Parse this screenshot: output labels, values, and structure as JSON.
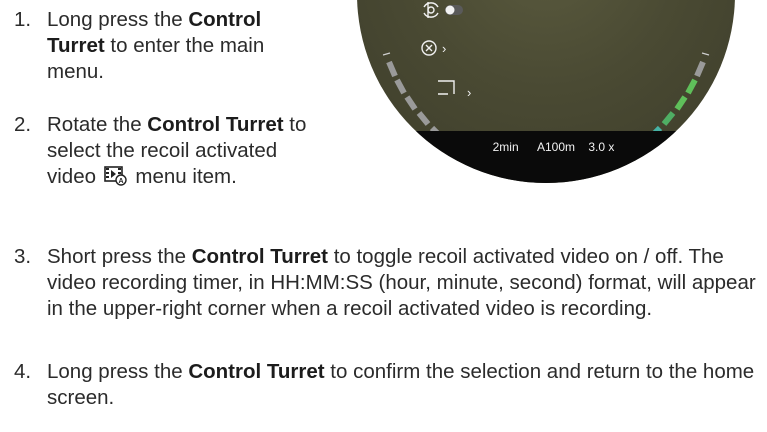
{
  "steps": [
    {
      "num": "1.",
      "parts": [
        "Long press the ",
        "Control Turret",
        " to enter the main menu."
      ]
    },
    {
      "num": "2.",
      "parts": [
        "Rotate the ",
        "Control Turret",
        " to select the recoil activated video ",
        " menu item."
      ]
    },
    {
      "num": "3.",
      "parts": [
        "Short press the ",
        "Control Turret",
        " to toggle recoil activated video on / off. The video recording timer, in HH:MM:SS (hour, minute, second) format, will appear in the upper-right corner when a recoil activated video is recording."
      ]
    },
    {
      "num": "4.",
      "parts": [
        "Long press the ",
        "Control Turret",
        " to confirm the selection and return to the home screen."
      ]
    }
  ],
  "scope": {
    "timer": "2min",
    "distance": "A100m",
    "zoom": "3.0 x",
    "menu_icons": [
      "gyro-icon",
      "toggle-switch",
      "crosshair-icon",
      "frame-icon"
    ],
    "chevron": "›",
    "accent_green": "#5fbf5a",
    "accent_teal": "#46b3a6"
  },
  "inline_icon": "recoil-video-icon"
}
